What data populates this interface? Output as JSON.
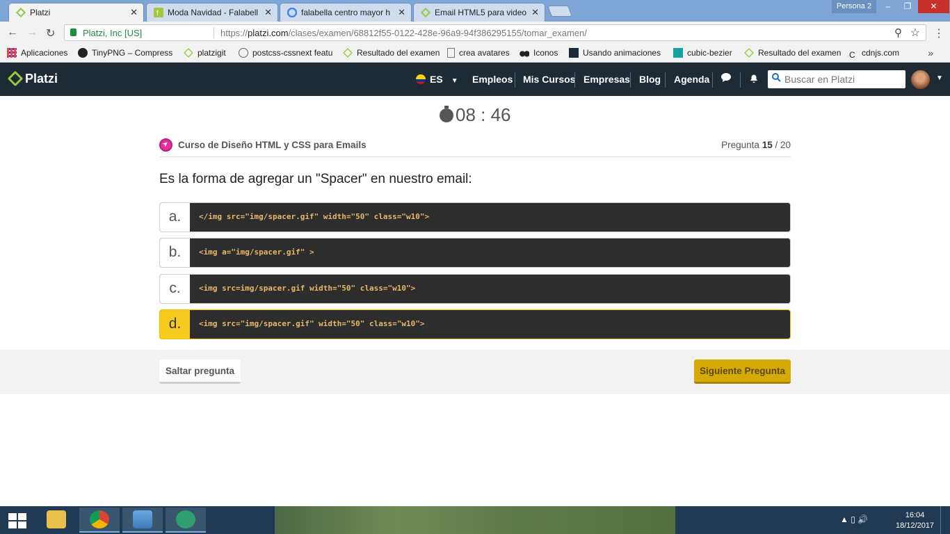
{
  "browser": {
    "tabs": [
      {
        "title": "Platzi",
        "active": true
      },
      {
        "title": "Moda Navidad - Falabell",
        "active": false
      },
      {
        "title": "falabella centro mayor h",
        "active": false
      },
      {
        "title": "Email HTML5 para video",
        "active": false
      }
    ],
    "profile": "Persona 2",
    "window_buttons": {
      "minimize": "–",
      "maximize": "❐",
      "close": "✕"
    },
    "address": {
      "site_identity": "Platzi, Inc [US]",
      "url_scheme": "https://",
      "url_host": "platzi.com",
      "url_path": "/clases/examen/68812f55-0122-428e-96a9-94f386295155/tomar_examen/"
    },
    "bookmarks": [
      {
        "label": "Aplicaciones",
        "icon": "apps-icon"
      },
      {
        "label": "TinyPNG – Compress",
        "icon": "panda-icon"
      },
      {
        "label": "platzigit",
        "icon": "platzi-icon"
      },
      {
        "label": "postcss-cssnext featu",
        "icon": "postcss-icon"
      },
      {
        "label": "Resultado del examen",
        "icon": "platzi-icon"
      },
      {
        "label": "crea avatares",
        "icon": "page-icon"
      },
      {
        "label": "Iconos",
        "icon": "bino-icon"
      },
      {
        "label": "Usando animaciones",
        "icon": "bird-icon"
      },
      {
        "label": "cubic-bezier",
        "icon": "curve-icon"
      },
      {
        "label": "Resultado del examen",
        "icon": "platzi-icon"
      },
      {
        "label": "cdnjs.com",
        "icon": "cdnjs-icon"
      }
    ],
    "bookmarks_more": "»"
  },
  "header": {
    "logo": "Platzi",
    "language": "ES",
    "nav": [
      "Empleos",
      "Mis Cursos",
      "Empresas",
      "Blog",
      "Agenda"
    ],
    "search_placeholder": "Buscar en Platzi"
  },
  "exam": {
    "timer": "08 : 46",
    "course_name": "Curso de Diseño HTML y CSS para Emails",
    "question_label": "Pregunta",
    "question_current": "15",
    "question_total": " / 20",
    "question_text": "Es la forma de agregar un \"Spacer\" en nuestro email:",
    "options": [
      {
        "letter": "a.",
        "code": "</img src=\"img/spacer.gif\" width=\"50\" class=\"w10\">",
        "selected": false
      },
      {
        "letter": "b.",
        "code": "<img a=\"img/spacer.gif\" >",
        "selected": false
      },
      {
        "letter": "c.",
        "code": "<img src=img/spacer.gif width=\"50\" class=\"w10\">",
        "selected": false
      },
      {
        "letter": "d.",
        "code": "<img src=\"img/spacer.gif\" width=\"50\" class=\"w10\">",
        "selected": true
      }
    ],
    "skip_label": "Saltar pregunta",
    "next_label": "Siguiente Pregunta"
  },
  "taskbar": {
    "time": "16:04",
    "date": "18/12/2017"
  },
  "colors": {
    "platzi_dark": "#1e2b35",
    "platzi_green": "#98ca3f",
    "selected_option": "#f6cb1e",
    "next_button": "#d5aa06",
    "code_bg": "#2d2d2d"
  }
}
